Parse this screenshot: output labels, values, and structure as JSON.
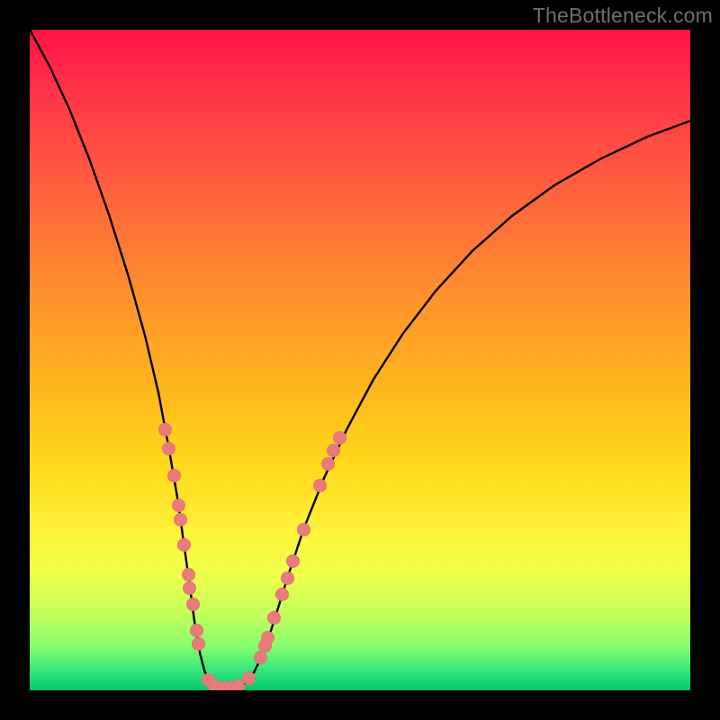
{
  "watermark": "TheBottleneck.com",
  "chart_data": {
    "type": "line",
    "title": "",
    "xlabel": "",
    "ylabel": "",
    "x_range": [
      0,
      1
    ],
    "y_range": [
      0,
      1
    ],
    "series": [
      {
        "name": "bottleneck-curve",
        "points": [
          [
            0.0,
            1.0
          ],
          [
            0.03,
            0.945
          ],
          [
            0.06,
            0.88
          ],
          [
            0.09,
            0.805
          ],
          [
            0.12,
            0.72
          ],
          [
            0.15,
            0.625
          ],
          [
            0.175,
            0.535
          ],
          [
            0.195,
            0.45
          ],
          [
            0.21,
            0.37
          ],
          [
            0.223,
            0.295
          ],
          [
            0.233,
            0.225
          ],
          [
            0.242,
            0.16
          ],
          [
            0.25,
            0.1
          ],
          [
            0.258,
            0.055
          ],
          [
            0.265,
            0.028
          ],
          [
            0.275,
            0.01
          ],
          [
            0.29,
            0.003
          ],
          [
            0.31,
            0.003
          ],
          [
            0.325,
            0.01
          ],
          [
            0.34,
            0.028
          ],
          [
            0.355,
            0.06
          ],
          [
            0.37,
            0.105
          ],
          [
            0.39,
            0.17
          ],
          [
            0.415,
            0.245
          ],
          [
            0.445,
            0.32
          ],
          [
            0.48,
            0.395
          ],
          [
            0.52,
            0.47
          ],
          [
            0.565,
            0.54
          ],
          [
            0.615,
            0.605
          ],
          [
            0.67,
            0.665
          ],
          [
            0.73,
            0.718
          ],
          [
            0.795,
            0.765
          ],
          [
            0.865,
            0.805
          ],
          [
            0.935,
            0.838
          ],
          [
            1.0,
            0.862
          ]
        ]
      }
    ],
    "markers": {
      "name": "highlight-points",
      "color": "#eb7a7d",
      "points": [
        [
          0.205,
          0.395
        ],
        [
          0.21,
          0.366
        ],
        [
          0.218,
          0.325
        ],
        [
          0.226,
          0.28
        ],
        [
          0.228,
          0.258
        ],
        [
          0.234,
          0.22
        ],
        [
          0.24,
          0.175
        ],
        [
          0.242,
          0.155
        ],
        [
          0.247,
          0.13
        ],
        [
          0.253,
          0.09
        ],
        [
          0.256,
          0.07
        ],
        [
          0.27,
          0.015
        ],
        [
          0.28,
          0.006
        ],
        [
          0.293,
          0.003
        ],
        [
          0.305,
          0.003
        ],
        [
          0.315,
          0.006
        ],
        [
          0.332,
          0.018
        ],
        [
          0.35,
          0.05
        ],
        [
          0.356,
          0.068
        ],
        [
          0.36,
          0.08
        ],
        [
          0.37,
          0.11
        ],
        [
          0.382,
          0.145
        ],
        [
          0.39,
          0.17
        ],
        [
          0.398,
          0.195
        ],
        [
          0.415,
          0.243
        ],
        [
          0.44,
          0.31
        ],
        [
          0.452,
          0.343
        ],
        [
          0.46,
          0.363
        ],
        [
          0.47,
          0.382
        ]
      ]
    }
  }
}
